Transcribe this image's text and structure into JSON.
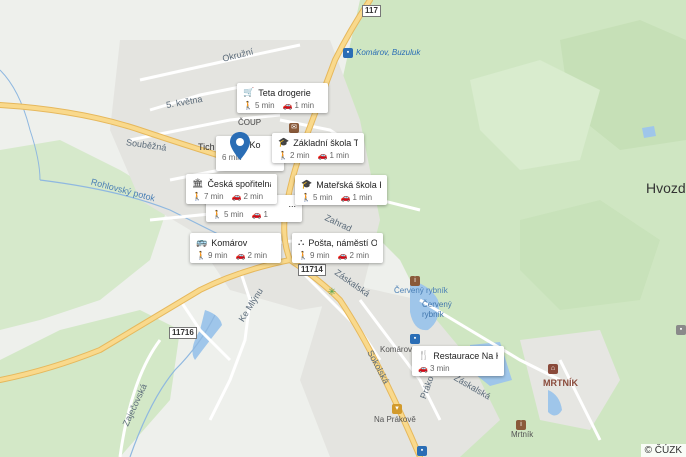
{
  "map": {
    "copyright": "© ČÚZK",
    "places": {
      "hvozd": "Hvozd",
      "mrtnik": "MRTNÍK",
      "mrtnik_small": "Mrtník",
      "cervenyRybnik1": "Červený rybník",
      "cervenyRybnik2": "Červený\nrybník",
      "komarovLabel": "Komárov, ...",
      "naPrakove": "Na Prákově",
      "busStop": "Komárov, Buzuluk",
      "cup": "ČOUP",
      "tich": "Tich"
    },
    "streets": {
      "okruzni": "Okružní",
      "petiKvetna": "5. května",
      "soubezna": "Souběžná",
      "rohlovsky": "Rohlovský potok",
      "zahrad": "Zahrad",
      "zaskalska1": "Záskalská",
      "zaskalska2": "Záskalská",
      "sokolska": "Sokolská",
      "prakova": "Prákova",
      "keMlynu": "Ke Mlýnu",
      "zajecovska": "Zaječovská"
    },
    "roads": {
      "r117": "117",
      "r11714": "11714",
      "r11716": "11716"
    }
  },
  "cards": [
    {
      "title": "Teta drogerie",
      "icon": "cart-icon",
      "walk": "5 min",
      "drive": "1 min"
    },
    {
      "title": "Základní škola T. ...",
      "icon": "school-icon",
      "walk": "2 min",
      "drive": "1 min"
    },
    {
      "title": "Mateřská škola K...",
      "icon": "school-icon",
      "walk": "5 min",
      "drive": "1 min"
    },
    {
      "title": "Česká spořitelna",
      "icon": "bank-icon",
      "walk": "7 min",
      "drive": "2 min"
    },
    {
      "title": "Komárov",
      "icon": "bus-icon",
      "walk": "9 min",
      "drive": "2 min"
    },
    {
      "title": "Pošta, náměstí O...",
      "icon": "post-icon",
      "walk": "9 min",
      "drive": "2 min"
    },
    {
      "title": "Restaurace Na K...",
      "icon": "restaurant-icon",
      "walk": "",
      "drive": "3 min"
    }
  ],
  "hidden_cards": {
    "partialA": {
      "title": "r. Ko",
      "walk": "6 min"
    },
    "partialB": {
      "title": "...",
      "walk": "5 min",
      "drive": "1"
    }
  }
}
